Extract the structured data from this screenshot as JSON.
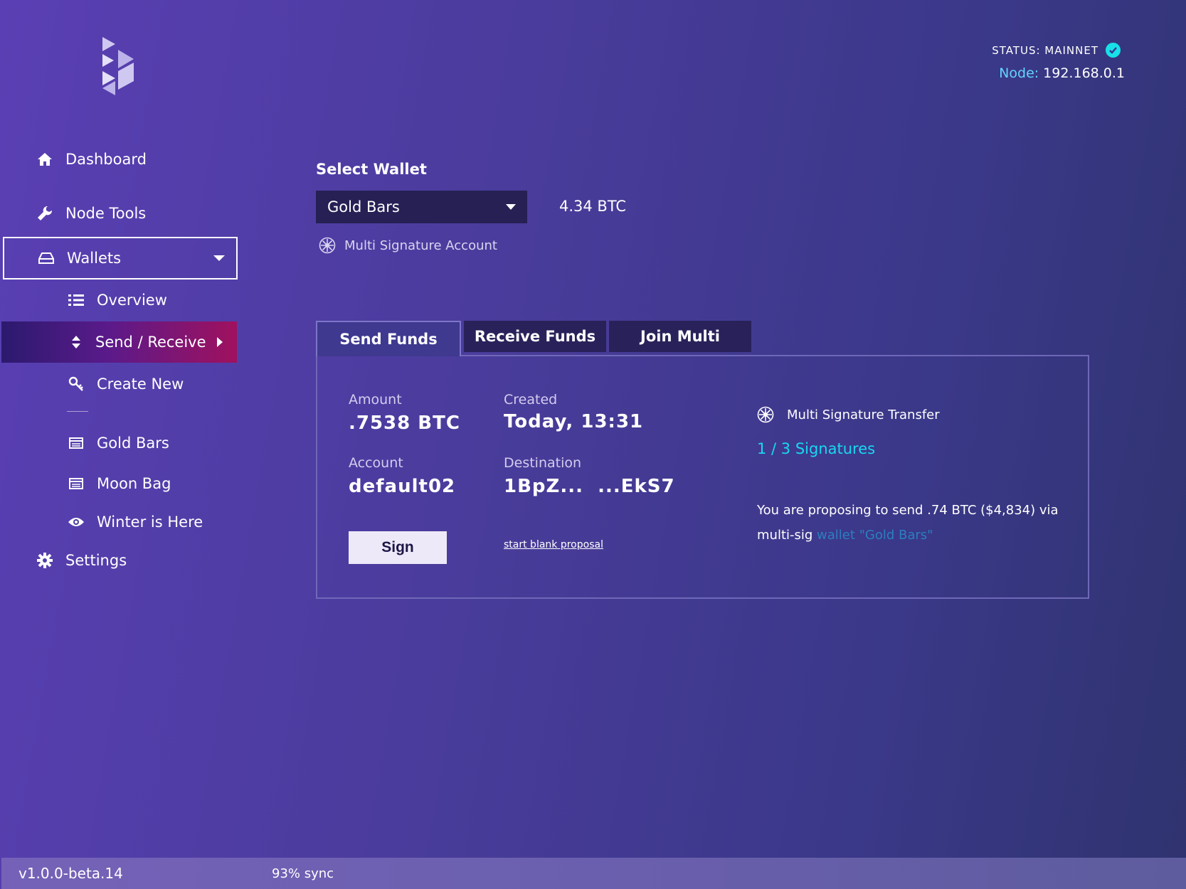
{
  "status": {
    "label": "STATUS: MAINNET",
    "node_label": "Node:",
    "node_value": "192.168.0.1",
    "ok_color": "#18e0e8"
  },
  "sidebar": {
    "dashboard": "Dashboard",
    "node_tools": "Node Tools",
    "wallets": "Wallets",
    "overview": "Overview",
    "send_receive": "Send / Receive",
    "create_new": "Create New",
    "wallet_list": [
      "Gold Bars",
      "Moon Bag",
      "Winter is Here"
    ],
    "settings": "Settings",
    "active_color": "#a0115e"
  },
  "wallet": {
    "title": "Select Wallet",
    "selected": "Gold Bars",
    "balance": "4.34 BTC",
    "account_type": "Multi Signature Account"
  },
  "tabs": [
    "Send Funds",
    "Receive Funds",
    "Join Multi"
  ],
  "transfer": {
    "amount_label": "Amount",
    "amount_value": ".7538 BTC",
    "created_label": "Created",
    "created_value": "Today, 13:31",
    "account_label": "Account",
    "account_value": "default02",
    "destination_label": "Destination",
    "destination_value": "1BpZ...  ...EkS7",
    "sign_label": "Sign",
    "blank_proposal": "start blank proposal",
    "multisig_title": "Multi Signature Transfer",
    "signatures": "1 / 3 Signatures",
    "proposal_text": "You are proposing to send .74 BTC ($4,834) via multi-sig ",
    "proposal_link": "wallet \"Gold Bars\""
  },
  "footer": {
    "version": "v1.0.0-beta.14",
    "sync": "93% sync"
  }
}
